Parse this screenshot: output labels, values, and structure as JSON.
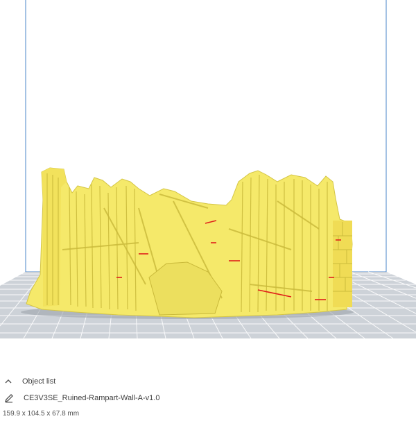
{
  "object_panel": {
    "list_label": "Object list",
    "file_name": "CE3V3SE_Ruined-Rampart-Wall-A-v1.0",
    "dimensions": "159.9 x 104.5 x 67.8 mm"
  },
  "icons": {
    "object_list_toggle": "chevron-up-icon",
    "edit_name": "pencil-icon"
  },
  "colors": {
    "model": "#f5e96a",
    "model_shadow": "#c9b93a",
    "overhang": "#e0201a",
    "build_plate": "#c8cdd4",
    "grid_line": "#ffffff",
    "build_volume_edge": "#4a86c8"
  }
}
